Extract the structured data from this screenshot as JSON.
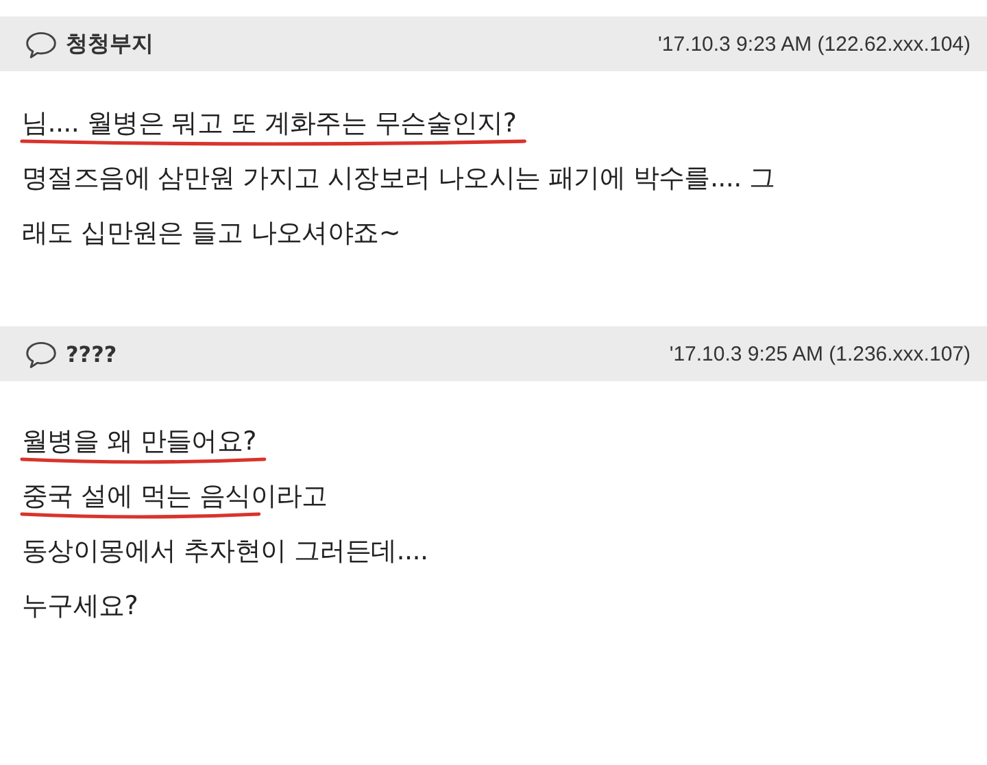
{
  "comments": [
    {
      "author": "청청부지",
      "meta": "'17.10.3 9:23 AM (122.62.xxx.104)",
      "lines": [
        {
          "segments": [
            {
              "text": "님.... 월병은 뭐고 또 계화주는 무슨술인지?",
              "underlined": true
            }
          ]
        },
        {
          "segments": [
            {
              "text": "명절즈음에 삼만원 가지고 시장보러 나오시는 패기에 박수를.... 그",
              "underlined": false
            }
          ]
        },
        {
          "segments": [
            {
              "text": "래도 십만원은 들고 나오셔야죠~",
              "underlined": false
            }
          ]
        }
      ]
    },
    {
      "author": "????",
      "meta": "'17.10.3 9:25 AM (1.236.xxx.107)",
      "lines": [
        {
          "segments": [
            {
              "text": "월병을 왜 만들어요?",
              "underlined": true
            }
          ]
        },
        {
          "segments": [
            {
              "text": "중국 설에 먹는 음식",
              "underlined": true
            },
            {
              "text": "이라고",
              "underlined": false
            }
          ]
        },
        {
          "segments": [
            {
              "text": "동상이몽에서 추자현이 그러든데....",
              "underlined": false
            }
          ]
        },
        {
          "segments": [
            {
              "text": "누구세요?",
              "underlined": false
            }
          ]
        }
      ]
    }
  ]
}
